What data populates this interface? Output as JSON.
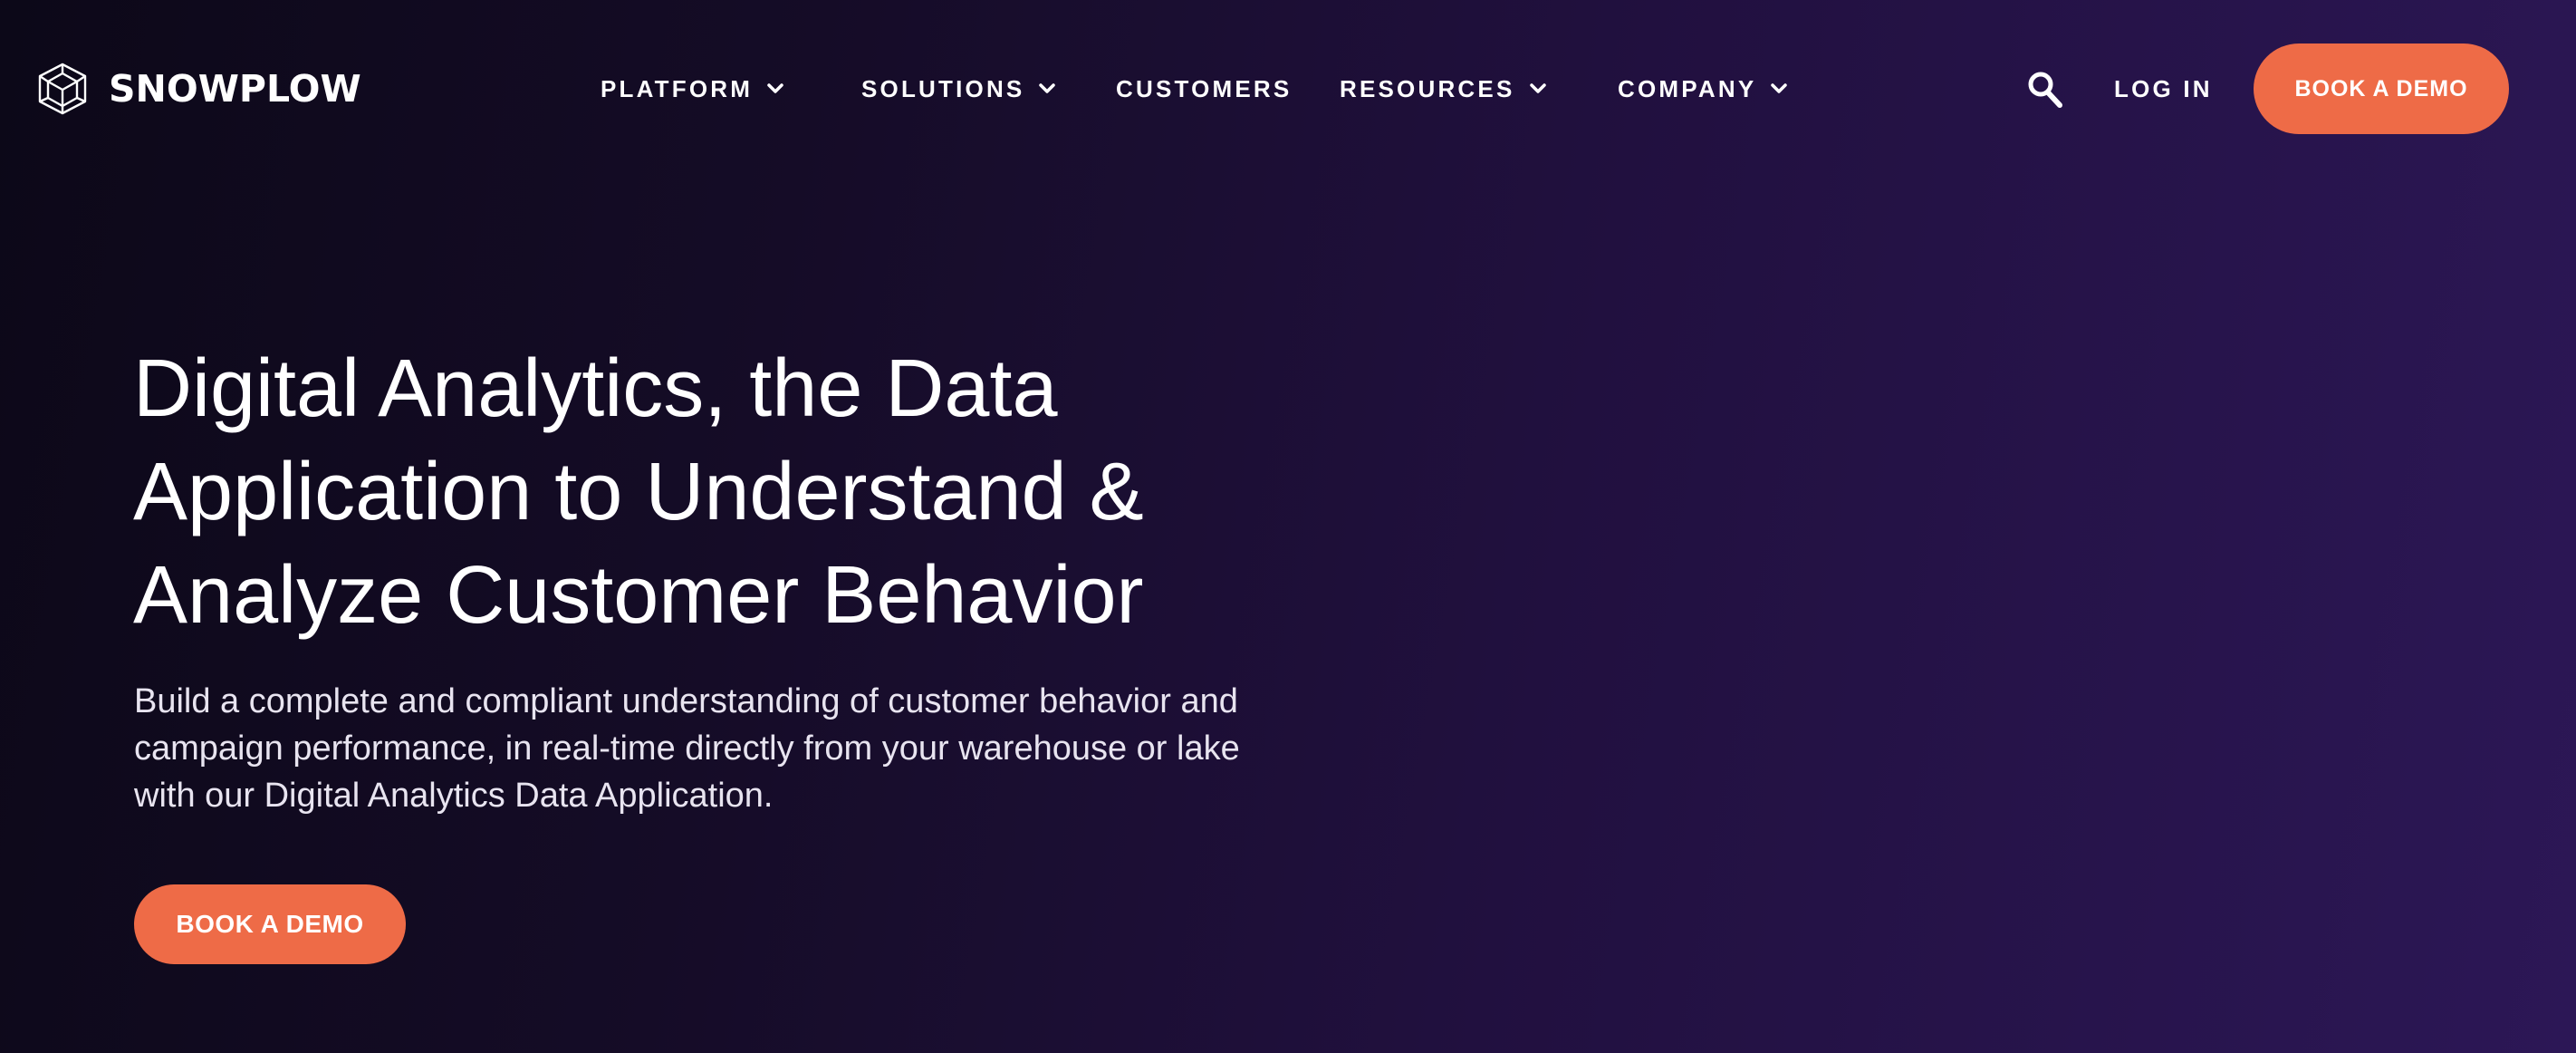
{
  "brand": {
    "name": "SNOWPLOW",
    "accent_color": "#ee6b47",
    "background_colors": [
      "#0c0818",
      "#2c1756"
    ]
  },
  "nav": {
    "items": [
      {
        "label": "PLATFORM",
        "has_dropdown": true,
        "icon": "chevron-down-icon"
      },
      {
        "label": "SOLUTIONS",
        "has_dropdown": true,
        "icon": "chevron-down-icon"
      },
      {
        "label": "CUSTOMERS",
        "has_dropdown": false
      },
      {
        "label": "RESOURCES",
        "has_dropdown": true,
        "icon": "chevron-down-icon"
      },
      {
        "label": "COMPANY",
        "has_dropdown": true,
        "icon": "chevron-down-icon"
      }
    ],
    "search_icon": "search-icon",
    "login_label": "LOG IN",
    "cta_label": "BOOK A DEMO"
  },
  "hero": {
    "title_lines": [
      "Digital Analytics, the Data",
      "Application to Understand &",
      "Analyze Customer Behavior"
    ],
    "subtitle_lines": [
      "Build a complete and compliant understanding of customer behavior and",
      "campaign performance, in real-time directly from your warehouse or lake",
      "with our Digital Analytics Data Application."
    ],
    "cta_label": "BOOK A DEMO"
  }
}
